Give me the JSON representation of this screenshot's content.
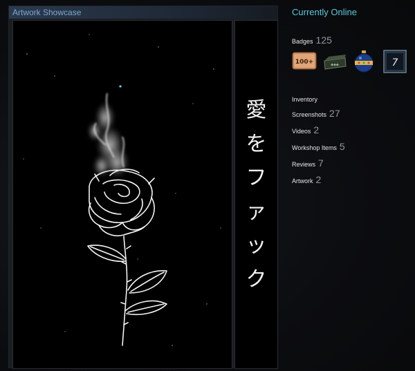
{
  "showcase": {
    "title": "Artwork Showcase",
    "vertical_text": [
      "愛",
      "を",
      "フ",
      "ァ",
      "ッ",
      "ク"
    ]
  },
  "profile": {
    "status": "Currently Online",
    "badges": {
      "label": "Badges",
      "count": "125",
      "items": [
        {
          "name": "100-plus-badge-icon",
          "text": "100+"
        },
        {
          "name": "crate-badge-icon",
          "text": ""
        },
        {
          "name": "ornament-badge-icon",
          "text": ""
        },
        {
          "name": "number-seven-badge-icon",
          "text": "7"
        }
      ]
    },
    "stats": [
      {
        "key": "inventory",
        "label": "Inventory",
        "count": ""
      },
      {
        "key": "screenshots",
        "label": "Screenshots",
        "count": "27"
      },
      {
        "key": "videos",
        "label": "Videos",
        "count": "2"
      },
      {
        "key": "workshop-items",
        "label": "Workshop Items",
        "count": "5"
      },
      {
        "key": "reviews",
        "label": "Reviews",
        "count": "7"
      },
      {
        "key": "artwork",
        "label": "Artwork",
        "count": "2"
      }
    ]
  },
  "colors": {
    "status_online": "#57cbde",
    "header_title": "#7fa8cc",
    "count_gray": "#8f98a0"
  }
}
